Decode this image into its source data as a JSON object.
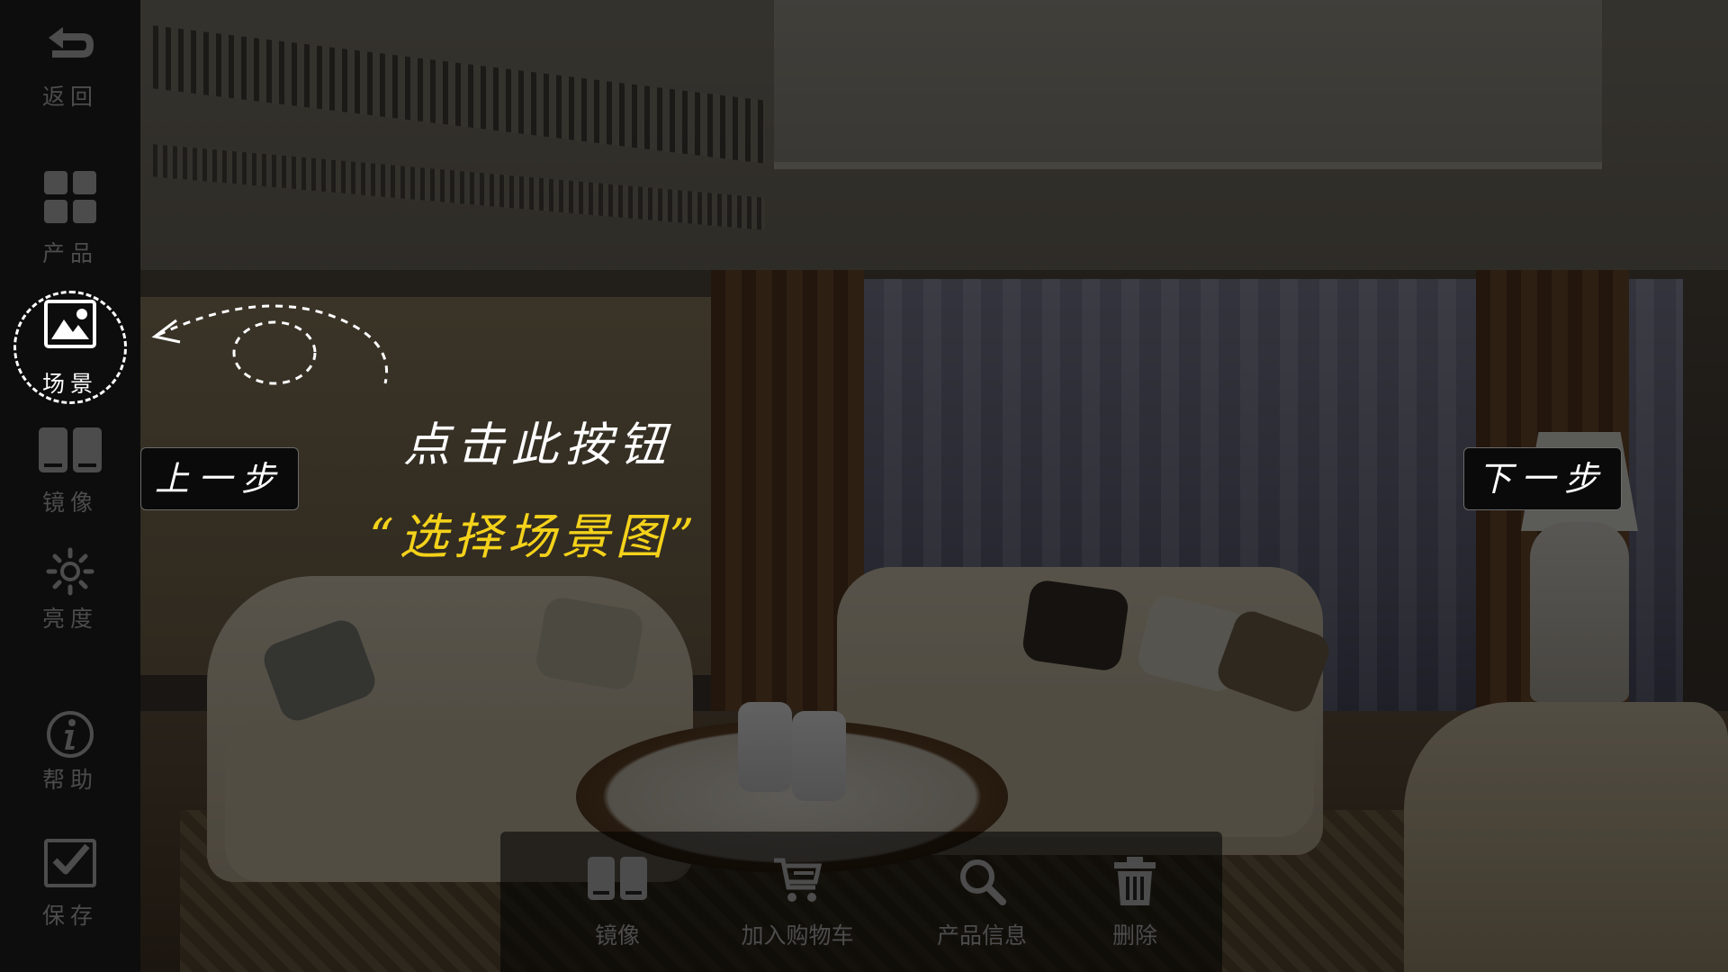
{
  "sidebar": {
    "items": [
      {
        "label": "返回",
        "icon": "back-arrow-icon"
      },
      {
        "label": "产品",
        "icon": "grid-icon"
      },
      {
        "label": "场景",
        "icon": "image-icon",
        "active": true
      },
      {
        "label": "镜像",
        "icon": "mirror-icon"
      },
      {
        "label": "亮度",
        "icon": "brightness-icon"
      },
      {
        "label": "帮助",
        "icon": "info-icon"
      },
      {
        "label": "保存",
        "icon": "save-check-icon"
      }
    ]
  },
  "guide": {
    "prev_label": "上一步",
    "next_label": "下一步",
    "instruction": "点击此按钮",
    "highlight": "“选择场景图”",
    "highlight_color": "#f4d21a"
  },
  "bottom_bar": {
    "items": [
      {
        "label": "镜像",
        "icon": "mirror-icon"
      },
      {
        "label": "加入购物车",
        "icon": "cart-icon"
      },
      {
        "label": "产品信息",
        "icon": "search-icon"
      },
      {
        "label": "删除",
        "icon": "trash-icon"
      }
    ]
  },
  "colors": {
    "sidebar_bg": "#0d0d0d",
    "inactive_text": "#4c4c4c",
    "active_text": "#ffffff"
  }
}
